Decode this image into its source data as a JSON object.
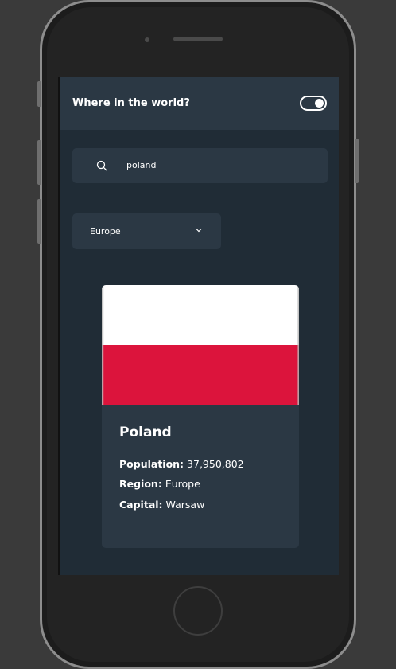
{
  "header": {
    "title": "Where in the world?",
    "theme_toggle": "on"
  },
  "search": {
    "value": "poland",
    "icon": "search-icon"
  },
  "filter": {
    "selected": "Europe",
    "icon": "chevron-down-icon"
  },
  "card": {
    "flag_colors": [
      "#ffffff",
      "#dc143c"
    ],
    "name": "Poland",
    "population_label": "Population:",
    "population_value": "37,950,802",
    "region_label": "Region:",
    "region_value": "Europe",
    "capital_label": "Capital:",
    "capital_value": "Warsaw"
  }
}
